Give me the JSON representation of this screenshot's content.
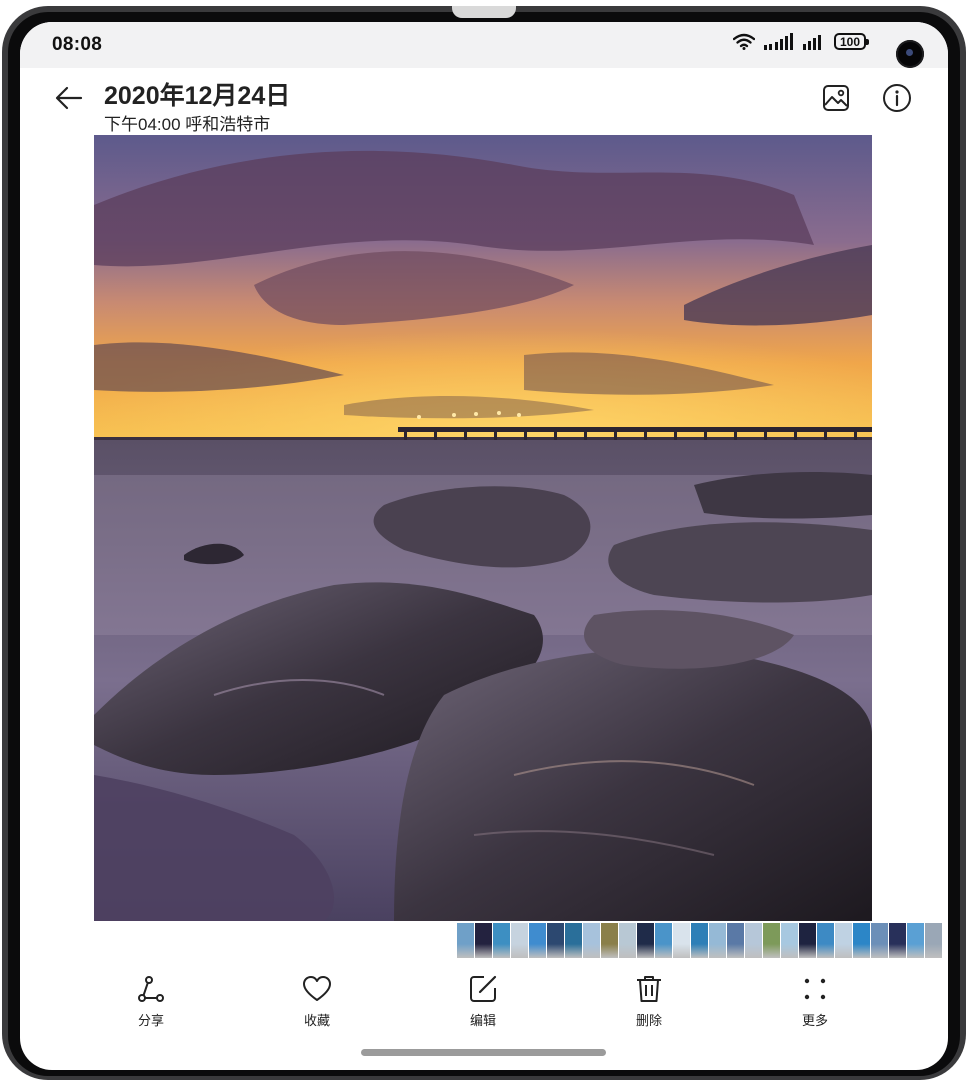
{
  "status_bar": {
    "time": "08:08",
    "battery": "100"
  },
  "header": {
    "title": "2020年12月24日",
    "subtitle": "下午04:00 呼和浩特市",
    "icons": [
      "back-arrow-icon",
      "image-icon",
      "info-icon"
    ]
  },
  "photo": {
    "scene": "sunset-pier-rocks"
  },
  "filmstrip": {
    "thumb_colors": [
      "#6fa0c8",
      "#23223f",
      "#3d8fc2",
      "#c6d3df",
      "#3f8ccf",
      "#2c4870",
      "#2a6f9a",
      "#a7c2dc",
      "#8a7f4a",
      "#b8c8d4",
      "#1f2b49",
      "#4a94c9",
      "#d9e3ec",
      "#2e7fb7",
      "#95b9d6",
      "#5a79a6",
      "#b6c7d9",
      "#7d9a5a",
      "#a7c8e0",
      "#1e2340",
      "#3d8ac4",
      "#bfd2e3",
      "#2c86c7",
      "#6c8fb8",
      "#28305a",
      "#5aa0d4",
      "#9aa7b6"
    ]
  },
  "toolbar": {
    "items": [
      {
        "label": "分享",
        "icon": "share-icon"
      },
      {
        "label": "收藏",
        "icon": "heart-icon"
      },
      {
        "label": "编辑",
        "icon": "edit-icon"
      },
      {
        "label": "删除",
        "icon": "trash-icon"
      },
      {
        "label": "更多",
        "icon": "more-icon"
      }
    ]
  }
}
